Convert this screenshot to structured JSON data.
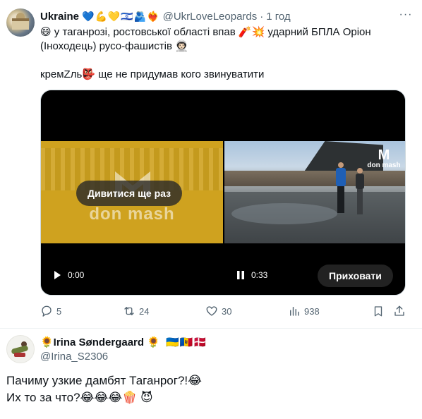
{
  "tweet": {
    "author_name": "Ukraine",
    "author_emojis": "💙💪💛🇮🇱🫂❤️‍🔥",
    "handle": "@UkrLoveLeopards",
    "separator": "·",
    "time": "1 год",
    "more_label": "···",
    "text_line1": "😄 у таганрозі, ростовської області впав 🧨💥 ударний БПЛА Оріон (Іноходець) русо-фашистів 👨🏻‍🚀",
    "text_line2": "кремZль👺 ще не придумав кого звинуватити",
    "video1": {
      "watermark": "don mash",
      "replay_label": "Дивитися ще раз",
      "time": "0:00"
    },
    "video2": {
      "watermark_top": "M",
      "watermark_bottom": "don mash",
      "time": "0:33",
      "hide_label": "Приховати"
    },
    "actions": {
      "replies": "5",
      "reposts": "24",
      "likes": "30",
      "views": "938"
    }
  },
  "reply": {
    "author_name": "🌻Irina Søndergaard 🌻",
    "author_flags": "🇺🇦🇲🇩🇩🇰",
    "handle": "@Irina_S2306",
    "text_line1": "Пачиму узкие дамбят Таганрог?!😂",
    "text_line2": "Их то за что?😂😂😂🍿 😈"
  }
}
